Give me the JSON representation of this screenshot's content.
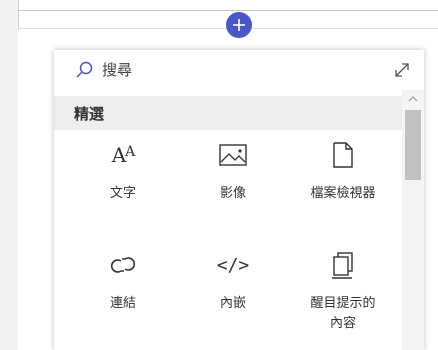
{
  "search": {
    "placeholder": "搜尋"
  },
  "category": {
    "title": "精選"
  },
  "tiles": [
    {
      "label": "文字",
      "icon": "text-icon"
    },
    {
      "label": "影像",
      "icon": "image-icon"
    },
    {
      "label": "檔案檢視器",
      "icon": "file-icon"
    },
    {
      "label": "連結",
      "icon": "link-icon"
    },
    {
      "label": "內嵌",
      "icon": "embed-code-icon"
    },
    {
      "label": "醒目提示的\n內容",
      "icon": "highlighted-content-icon"
    }
  ],
  "colors": {
    "accent": "#4a56c8",
    "text": "#333333",
    "header_bg": "#eeeeee"
  }
}
